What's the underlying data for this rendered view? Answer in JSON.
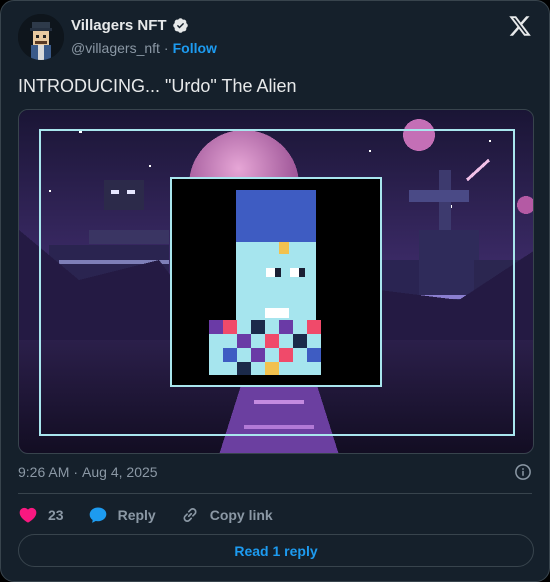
{
  "account": {
    "display_name": "Villagers NFT",
    "handle": "@villagers_nft",
    "separator": "·",
    "follow_label": "Follow",
    "verified": true
  },
  "tweet": {
    "text": "INTRODUCING... \"Urdo\" The Alien",
    "time": "9:26 AM",
    "separator": "·",
    "date": "Aug 4, 2025"
  },
  "actions": {
    "like_count": "23",
    "reply_label": "Reply",
    "copy_link_label": "Copy link"
  },
  "read_replies_label": "Read 1 reply",
  "colors": {
    "background": "#15202b",
    "accent": "#1d9bf0",
    "like": "#f91880",
    "text": "#e7e9ea",
    "muted": "#8b98a5",
    "border": "#38444d"
  },
  "icons": [
    "x-logo-icon",
    "verified-badge-icon",
    "info-icon",
    "heart-icon",
    "reply-bubble-icon",
    "link-icon"
  ]
}
